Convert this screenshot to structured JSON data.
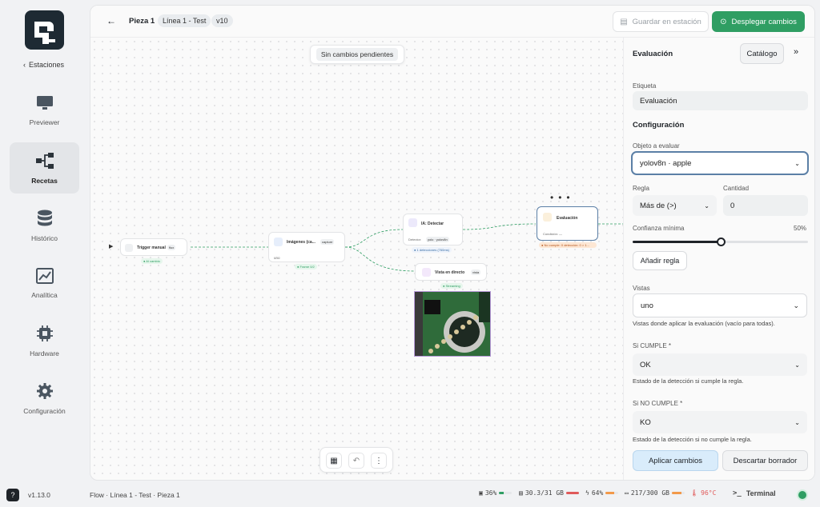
{
  "sidebar": {
    "back_label": "Estaciones",
    "items": [
      {
        "label": "Previewer",
        "icon": "monitor-icon"
      },
      {
        "label": "Recetas",
        "icon": "workflow-icon"
      },
      {
        "label": "Histórico",
        "icon": "database-icon"
      },
      {
        "label": "Analítica",
        "icon": "chart-icon"
      },
      {
        "label": "Hardware",
        "icon": "chip-icon"
      },
      {
        "label": "Configuración",
        "icon": "gear-icon"
      }
    ]
  },
  "topbar": {
    "title": "Pieza 1",
    "line_badge": "Línea 1 - Test",
    "version_badge": "v10",
    "save_label": "Guardar en estación",
    "deploy_label": "Desplegar cambios"
  },
  "canvas": {
    "pending_label": "Sin cambios pendientes",
    "nodes": {
      "trigger": {
        "title": "Trigger manual",
        "chip": "flux",
        "tag": "● Al cambio"
      },
      "images": {
        "title": "Imágenes (ca...",
        "chip": "capture",
        "sub": "uno",
        "tag": "● Frame 0/2"
      },
      "detect": {
        "title": "IA: Detectar",
        "row_label": "Detector:",
        "row_value": "yolo · yolov8n",
        "tag": "● 1 detecciones (760ms)"
      },
      "live": {
        "title": "Vista en directo",
        "chip": "vista",
        "tag": "● Streaming"
      },
      "eval": {
        "title": "Evaluación",
        "sub": "Condición: —",
        "tag": "● No cumple: 0 detección: 0 > 1..."
      }
    }
  },
  "panel": {
    "title": "Evaluación",
    "catalog_label": "Catálogo",
    "etiqueta_label": "Etiqueta",
    "etiqueta_value": "Evaluación",
    "config_label": "Configuración",
    "objeto_label": "Objeto a evaluar",
    "objeto_value": "yolov8n · apple",
    "regla_label": "Regla",
    "regla_value": "Más de (>)",
    "cantidad_label": "Cantidad",
    "cantidad_value": "0",
    "confianza_label": "Confianza mínima",
    "confianza_value": "50%",
    "confianza_fraction": 0.5,
    "add_rule_label": "Añadir regla",
    "vistas_label": "Vistas",
    "vistas_value": "uno",
    "vistas_help": "Vistas donde aplicar la evaluación (vacío para todas).",
    "cumple_label": "Si CUMPLE *",
    "cumple_value": "OK",
    "cumple_help": "Estado de la detección si cumple la regla.",
    "nocumple_label": "Si NO CUMPLE *",
    "nocumple_value": "KO",
    "nocumple_help": "Estado de la detección si no cumple la regla.",
    "apply_label": "Aplicar cambios",
    "discard_label": "Descartar borrador"
  },
  "statusbar": {
    "version": "v1.13.0",
    "breadcrumb": "Flow · Línea 1 - Test · Pieza 1",
    "cpu": "36%",
    "cpu_fraction": 0.36,
    "ram": "30.3/31 GB",
    "ram_fraction": 0.98,
    "gpu": "64%",
    "gpu_fraction": 0.64,
    "disk": "217/300 GB",
    "disk_fraction": 0.72,
    "temp": "96°C",
    "terminal_label": "Terminal"
  },
  "colors": {
    "accent": "#2f9e63",
    "selection": "#5b7fa6",
    "warning": "#f2994a",
    "danger": "#e05a5a"
  }
}
